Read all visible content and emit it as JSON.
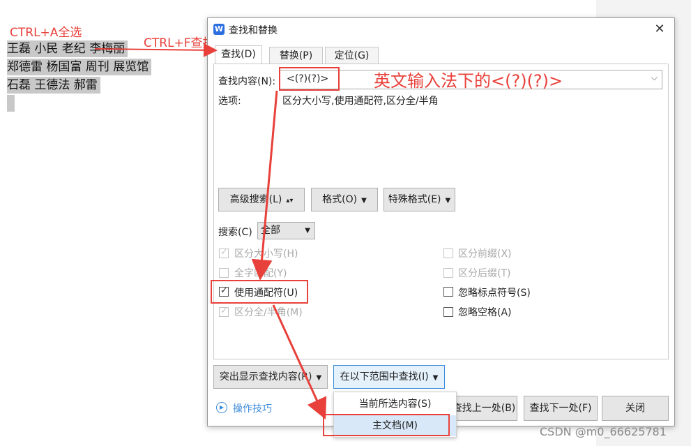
{
  "document": {
    "lines": [
      "王磊 小民 老纪 李梅丽",
      "郑德雷 杨国富 周刊 展览馆",
      "石磊 王德法 郝雷"
    ]
  },
  "annotations": {
    "select_all": "CTRL+A全选",
    "find": "CTRL+F查找",
    "ime_hint": "英文输入法下的<(?)(?)>"
  },
  "dialog": {
    "title": "查找和替换",
    "close_glyph": "✕",
    "app_icon_glyph": "W",
    "tabs": [
      "查找(D)",
      "替换(P)",
      "定位(G)"
    ],
    "find_label": "查找内容(N):",
    "find_value": "<(?)(?)>",
    "options_label": "选项:",
    "options_value": "区分大小写,使用通配符,区分全/半角",
    "advanced_button": "高级搜索(L)",
    "format_button": "格式(O)",
    "special_button": "特殊格式(E)",
    "search_label": "搜索(C)",
    "search_value": "全部",
    "checkboxes": {
      "case": {
        "label": "区分大小写(H)",
        "checked": true,
        "disabled": true
      },
      "whole_word": {
        "label": "全字匹配(Y)",
        "checked": false,
        "disabled": true
      },
      "wildcards": {
        "label": "使用通配符(U)",
        "checked": true,
        "disabled": false
      },
      "width": {
        "label": "区分全/半角(M)",
        "checked": true,
        "disabled": true
      },
      "prefix": {
        "label": "区分前缀(X)",
        "checked": false,
        "disabled": true
      },
      "suffix": {
        "label": "区分后缀(T)",
        "checked": false,
        "disabled": true
      },
      "ignore_punct": {
        "label": "忽略标点符号(S)",
        "checked": false,
        "disabled": false
      },
      "ignore_space": {
        "label": "忽略空格(A)",
        "checked": false,
        "disabled": false
      }
    },
    "highlight_button": "突出显示查找内容(R)",
    "find_in_button": "在以下范围中查找(I)",
    "tips_link": "操作技巧",
    "find_prev_button": "查找上一处(B)",
    "find_next_button": "查找下一处(F)",
    "close_button": "关闭",
    "dropdown": [
      "当前所选内容(S)",
      "主文档(M)"
    ]
  },
  "watermark": "CSDN @m0_66625781",
  "colors": {
    "annotation": "#e8403a",
    "accent": "#2b6fe0"
  }
}
